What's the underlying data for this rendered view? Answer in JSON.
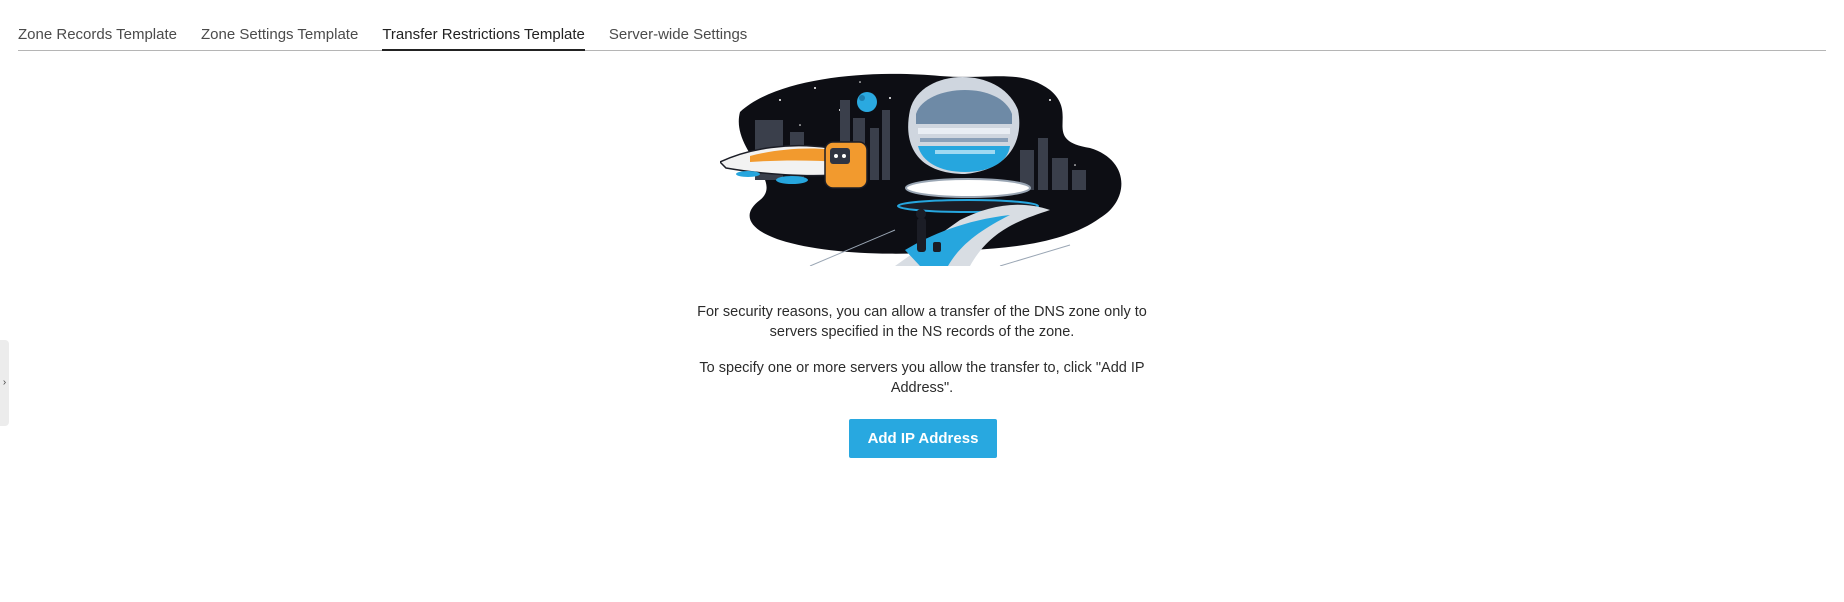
{
  "tabs": [
    {
      "label": "Zone Records Template",
      "active": false
    },
    {
      "label": "Zone Settings Template",
      "active": false
    },
    {
      "label": "Transfer Restrictions Template",
      "active": true
    },
    {
      "label": "Server-wide Settings",
      "active": false
    }
  ],
  "sidebar_toggle": {
    "glyph": "›",
    "icon": "chevron-right-icon"
  },
  "illustration": {
    "icon": "space-city-illustration"
  },
  "content": {
    "paragraph_1": "For security reasons, you can allow a transfer of the DNS zone only to servers specified in the NS records of the zone.",
    "paragraph_2": "To specify one or more servers you allow the transfer to, click \"Add IP Address\"."
  },
  "actions": {
    "add_ip_label": "Add IP Address"
  },
  "colors": {
    "accent": "#28a8e0",
    "tab_border": "#b5b5b5",
    "text": "#222222"
  }
}
